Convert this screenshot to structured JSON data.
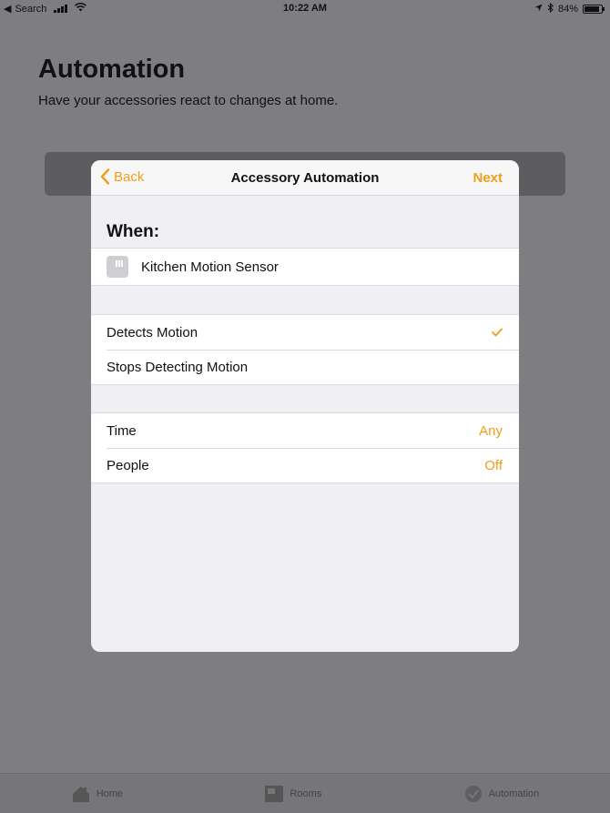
{
  "status_bar": {
    "back_label": "Search",
    "time": "10:22 AM",
    "battery": "84%"
  },
  "background": {
    "title": "Automation",
    "subtitle": "Have your accessories react to changes at home."
  },
  "tab_bar": {
    "items": [
      {
        "label": "Home",
        "icon": "house-icon"
      },
      {
        "label": "Rooms",
        "icon": "rooms-icon"
      },
      {
        "label": "Automation",
        "icon": "clock-check-icon"
      }
    ]
  },
  "modal": {
    "nav": {
      "back_label": "Back",
      "title": "Accessory Automation",
      "next_label": "Next"
    },
    "when_header": "When:",
    "device": {
      "name": "Kitchen Motion Sensor",
      "icon": "motion-sensor-icon"
    },
    "triggers": [
      {
        "label": "Detects Motion",
        "checked": true
      },
      {
        "label": "Stops Detecting Motion",
        "checked": false
      }
    ],
    "conditions": [
      {
        "label": "Time",
        "value": "Any"
      },
      {
        "label": "People",
        "value": "Off"
      }
    ]
  },
  "colors": {
    "accent": "#f29c1b",
    "dim_background": "#7d7d82",
    "sheet_background": "#efeff4"
  }
}
